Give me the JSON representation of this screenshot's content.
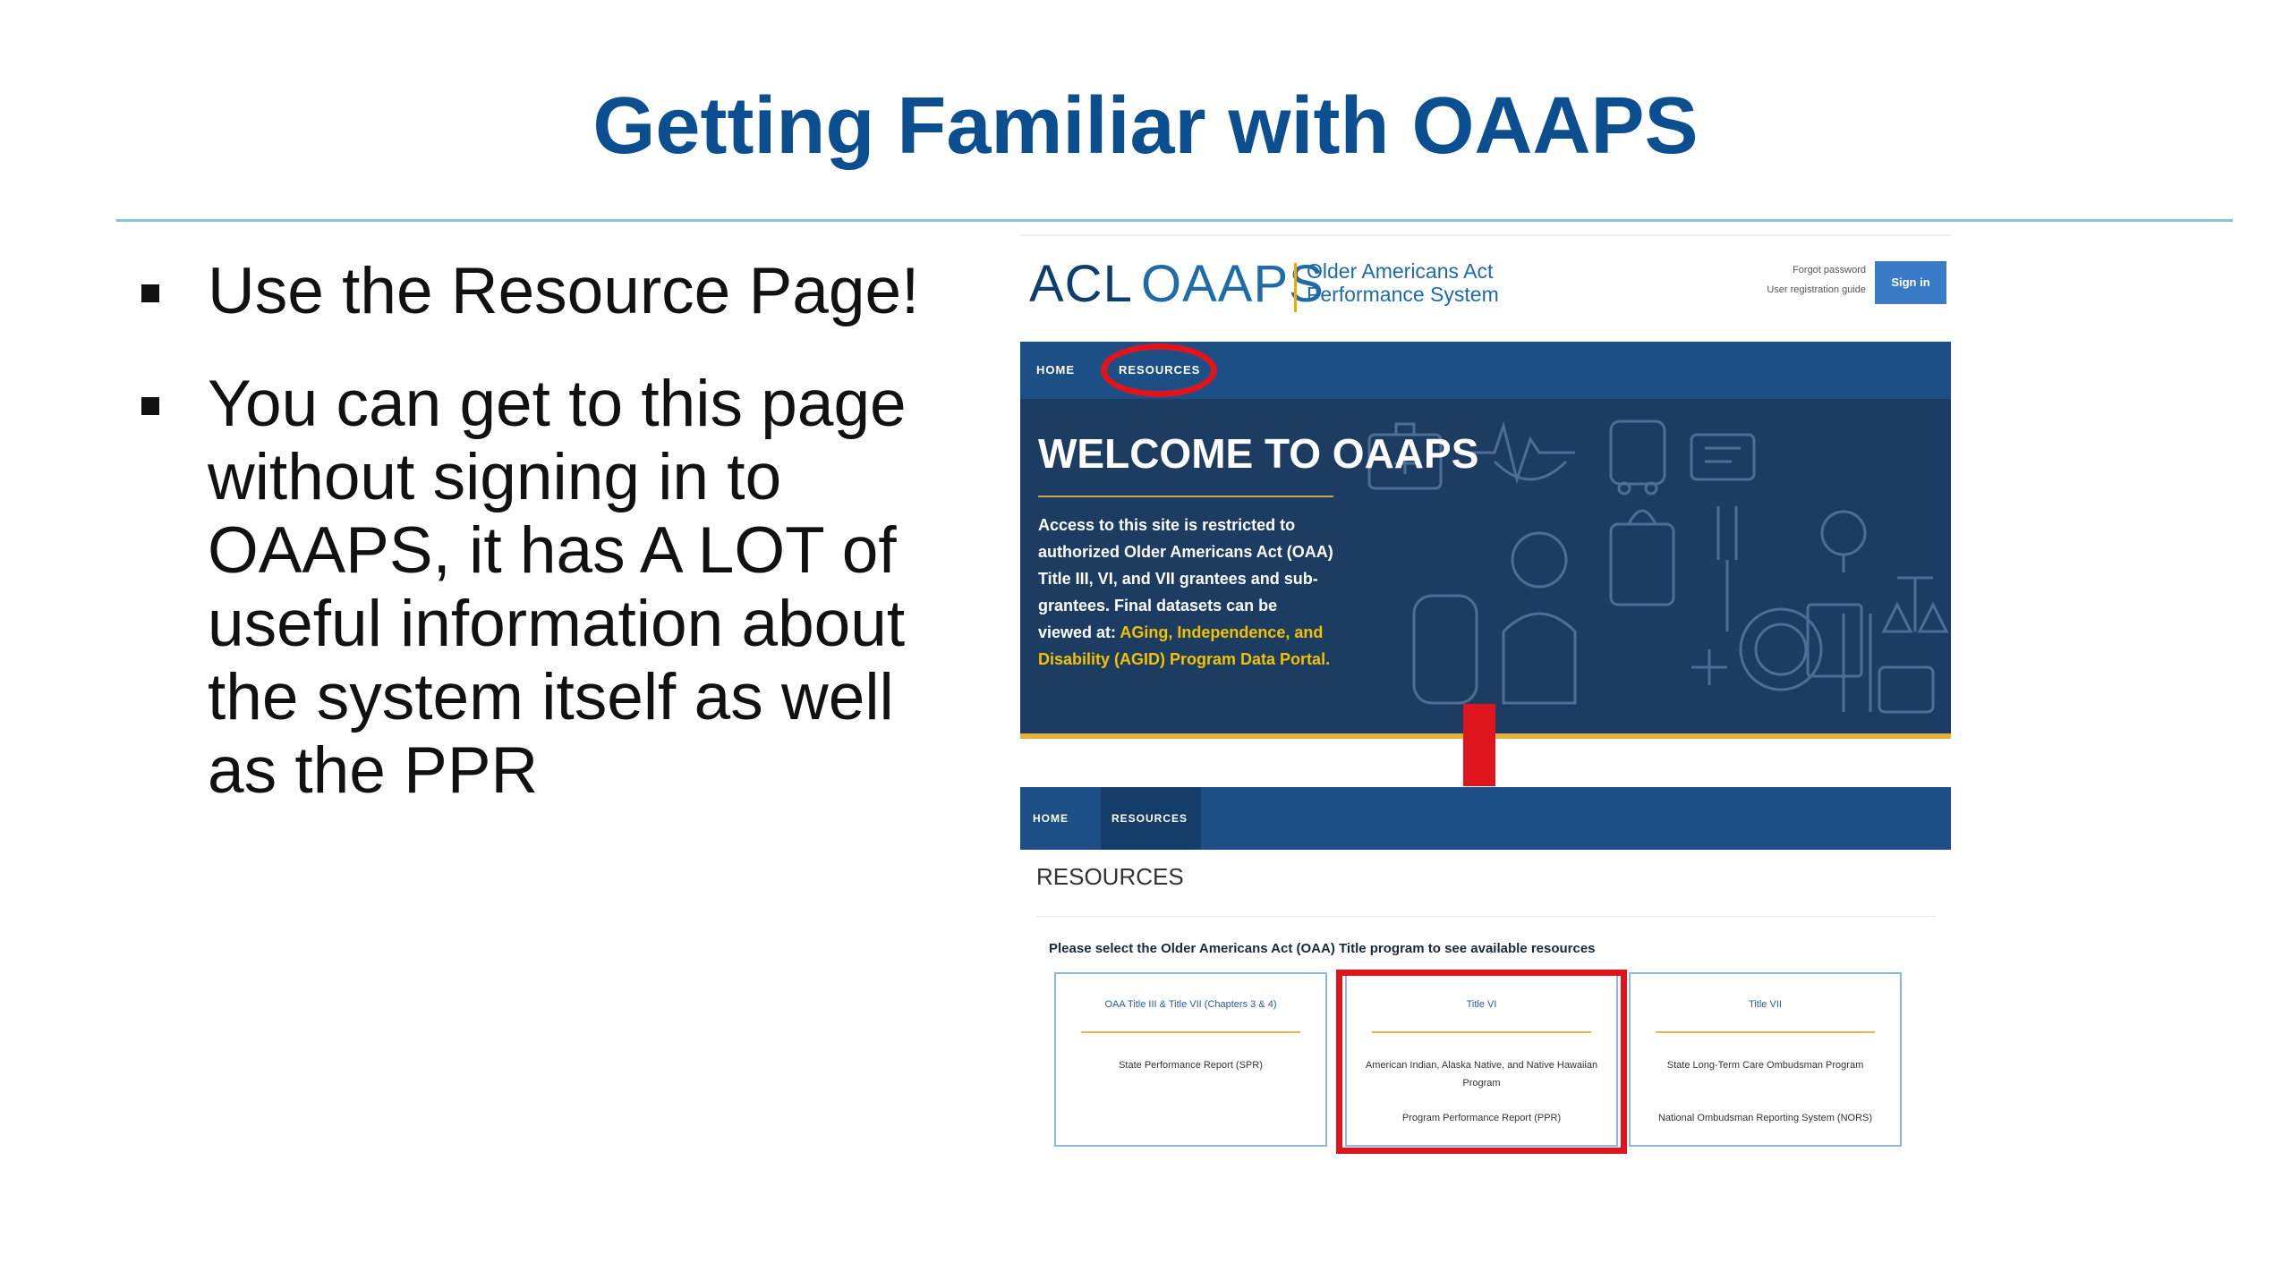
{
  "slide": {
    "title": "Getting Familiar with OAAPS",
    "bullets": [
      "Use the Resource Page!",
      "You can get to this page without signing in to OAAPS, it has A LOT of useful information about the system itself as well as the PPR"
    ]
  },
  "screenshot": {
    "header": {
      "logo_acl": "ACL",
      "logo_oaaps": "OAAPS",
      "logo_sub_line1": "Older Americans Act",
      "logo_sub_line2": "Performance System",
      "forgot_password": "Forgot password",
      "user_guide": "User registration guide",
      "sign_in": "Sign in"
    },
    "nav": {
      "home": "HOME",
      "resources": "RESOURCES"
    },
    "hero": {
      "title": "WELCOME TO OAAPS",
      "text": "Access to this site is restricted to authorized Older Americans Act (OAA) Title III, VI, and VII grantees and sub-grantees. Final datasets can be viewed at: ",
      "link": "AGing, Independence, and Disability (AGID) Program Data Portal."
    },
    "resources": {
      "heading": "RESOURCES",
      "instruction": "Please select the Older Americans Act (OAA) Title program to see available resources",
      "cards": [
        {
          "title": "OAA Title III & Title VII (Chapters 3 & 4)",
          "line1": "State Performance Report (SPR)",
          "line2": ""
        },
        {
          "title": "Title VI",
          "line1": "American Indian, Alaska Native, and Native Hawaiian Program",
          "line2": "Program Performance Report (PPR)"
        },
        {
          "title": "Title VII",
          "line1": "State Long-Term Care Ombudsman Program",
          "line2": "National Ombudsman Reporting System (NORS)"
        }
      ]
    }
  },
  "colors": {
    "title_blue": "#0b4f91",
    "nav_blue": "#1b4f86",
    "hero_navy": "#1d3c62",
    "highlight_red": "#e0141c",
    "accent_gold": "#e3b23c"
  }
}
